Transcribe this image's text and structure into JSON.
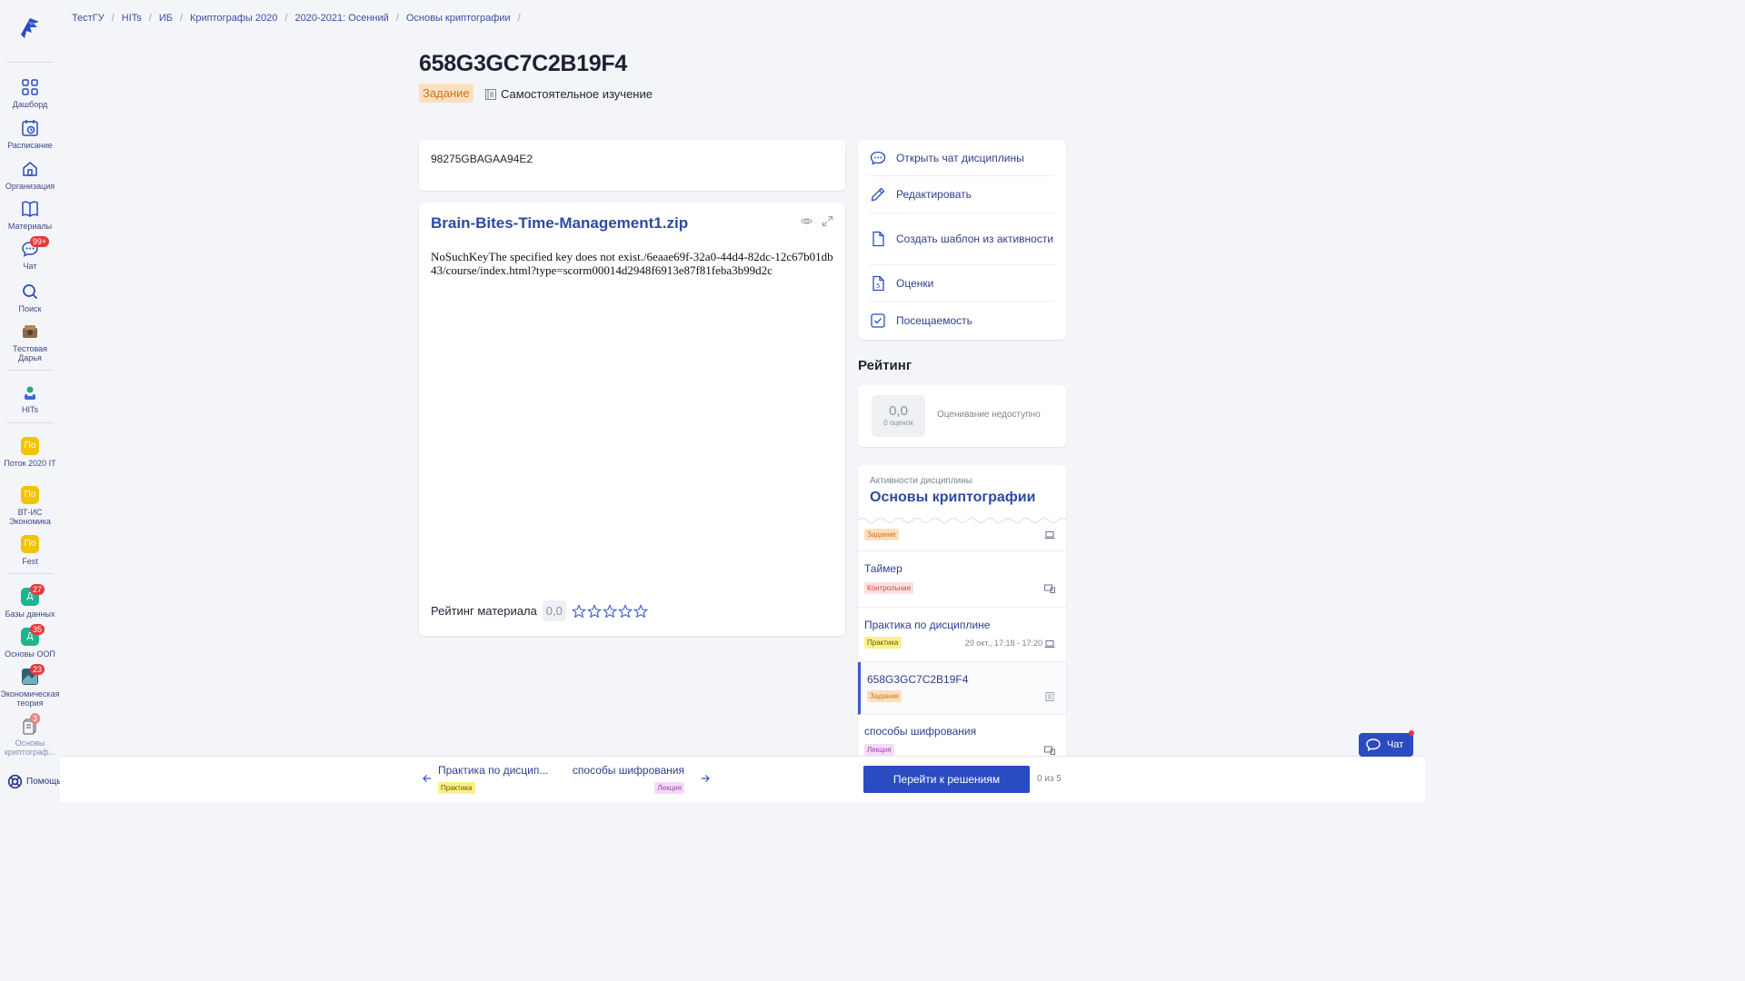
{
  "breadcrumb": [
    "ТестГУ",
    "HITs",
    "ИБ",
    "Криптографы 2020",
    "2020-2021: Осенний",
    "Основы криптографии"
  ],
  "page": {
    "title": "658G3GC7C2B19F4",
    "type_tag": "Задание",
    "mode": "Самостоятельное изучение",
    "code": "98275GBAGAA94E2"
  },
  "file": {
    "name": "Brain-Bites-Time-Management1.zip",
    "error": "NoSuchKeyThe specified key does not exist./6eaae69f-32a0-44d4-82dc-12c67b01db43/course/index.html?type=scorm00014d2948f6913e87f81feba3b99d2c",
    "rating_label": "Рейтинг материала",
    "rating_value": "0,0"
  },
  "sidebar": {
    "items": [
      {
        "label": "Дашборд"
      },
      {
        "label": "Расписание"
      },
      {
        "label": "Организация"
      },
      {
        "label": "Материалы"
      },
      {
        "label": "Чат",
        "badge": "99+"
      },
      {
        "label": "Поиск"
      },
      {
        "label": "Тестовая Дарья"
      },
      {
        "label": "HITs"
      },
      {
        "label": "Поток 2020 IT",
        "abbr": "По"
      },
      {
        "label": "ВТ-ИС Экономика",
        "abbr": "По"
      },
      {
        "label": "Fest",
        "abbr": "По"
      },
      {
        "label": "Базы данных",
        "abbr": "Д",
        "badge": "27"
      },
      {
        "label": "Основы ООП",
        "abbr": "Д",
        "badge": "35"
      },
      {
        "label": "Экономическая теория",
        "badge": "23"
      },
      {
        "label": "Основы криптограф...",
        "badge": "3"
      }
    ],
    "help": "Помощь"
  },
  "menu": {
    "items": [
      "Открыть чат дисциплины",
      "Редактировать",
      "Создать шаблон из активности",
      "Оценки",
      "Посещаемость"
    ]
  },
  "rating": {
    "heading": "Рейтинг",
    "value": "0,0",
    "count": "0 оценок",
    "note": "Оценивание недоступно"
  },
  "activities": {
    "subtitle": "Активности дисциплины",
    "title": "Основы криптографии",
    "items": [
      {
        "name": "",
        "tag": "Задание"
      },
      {
        "name": "Таймер",
        "tag": "Контрольная"
      },
      {
        "name": "Практика по дисциплине",
        "tag": "Практика",
        "date": "29 окт., 17:18 - 17:20"
      },
      {
        "name": "658G3GC7C2B19F4",
        "tag": "Задание"
      },
      {
        "name": "способы шифрования",
        "tag": "Лекция"
      }
    ]
  },
  "bottom": {
    "prev_name": "Практика по дисцип...",
    "prev_tag": "Практика",
    "next_name": "способы шифрования",
    "next_tag": "Лекция",
    "solve_button": "Перейти к решениям",
    "count": "0 из 5"
  },
  "chat_button": "Чат",
  "colors": {
    "accent": "#2b4bc2",
    "link": "#2f4aa0",
    "badge": "#e23b3b"
  }
}
